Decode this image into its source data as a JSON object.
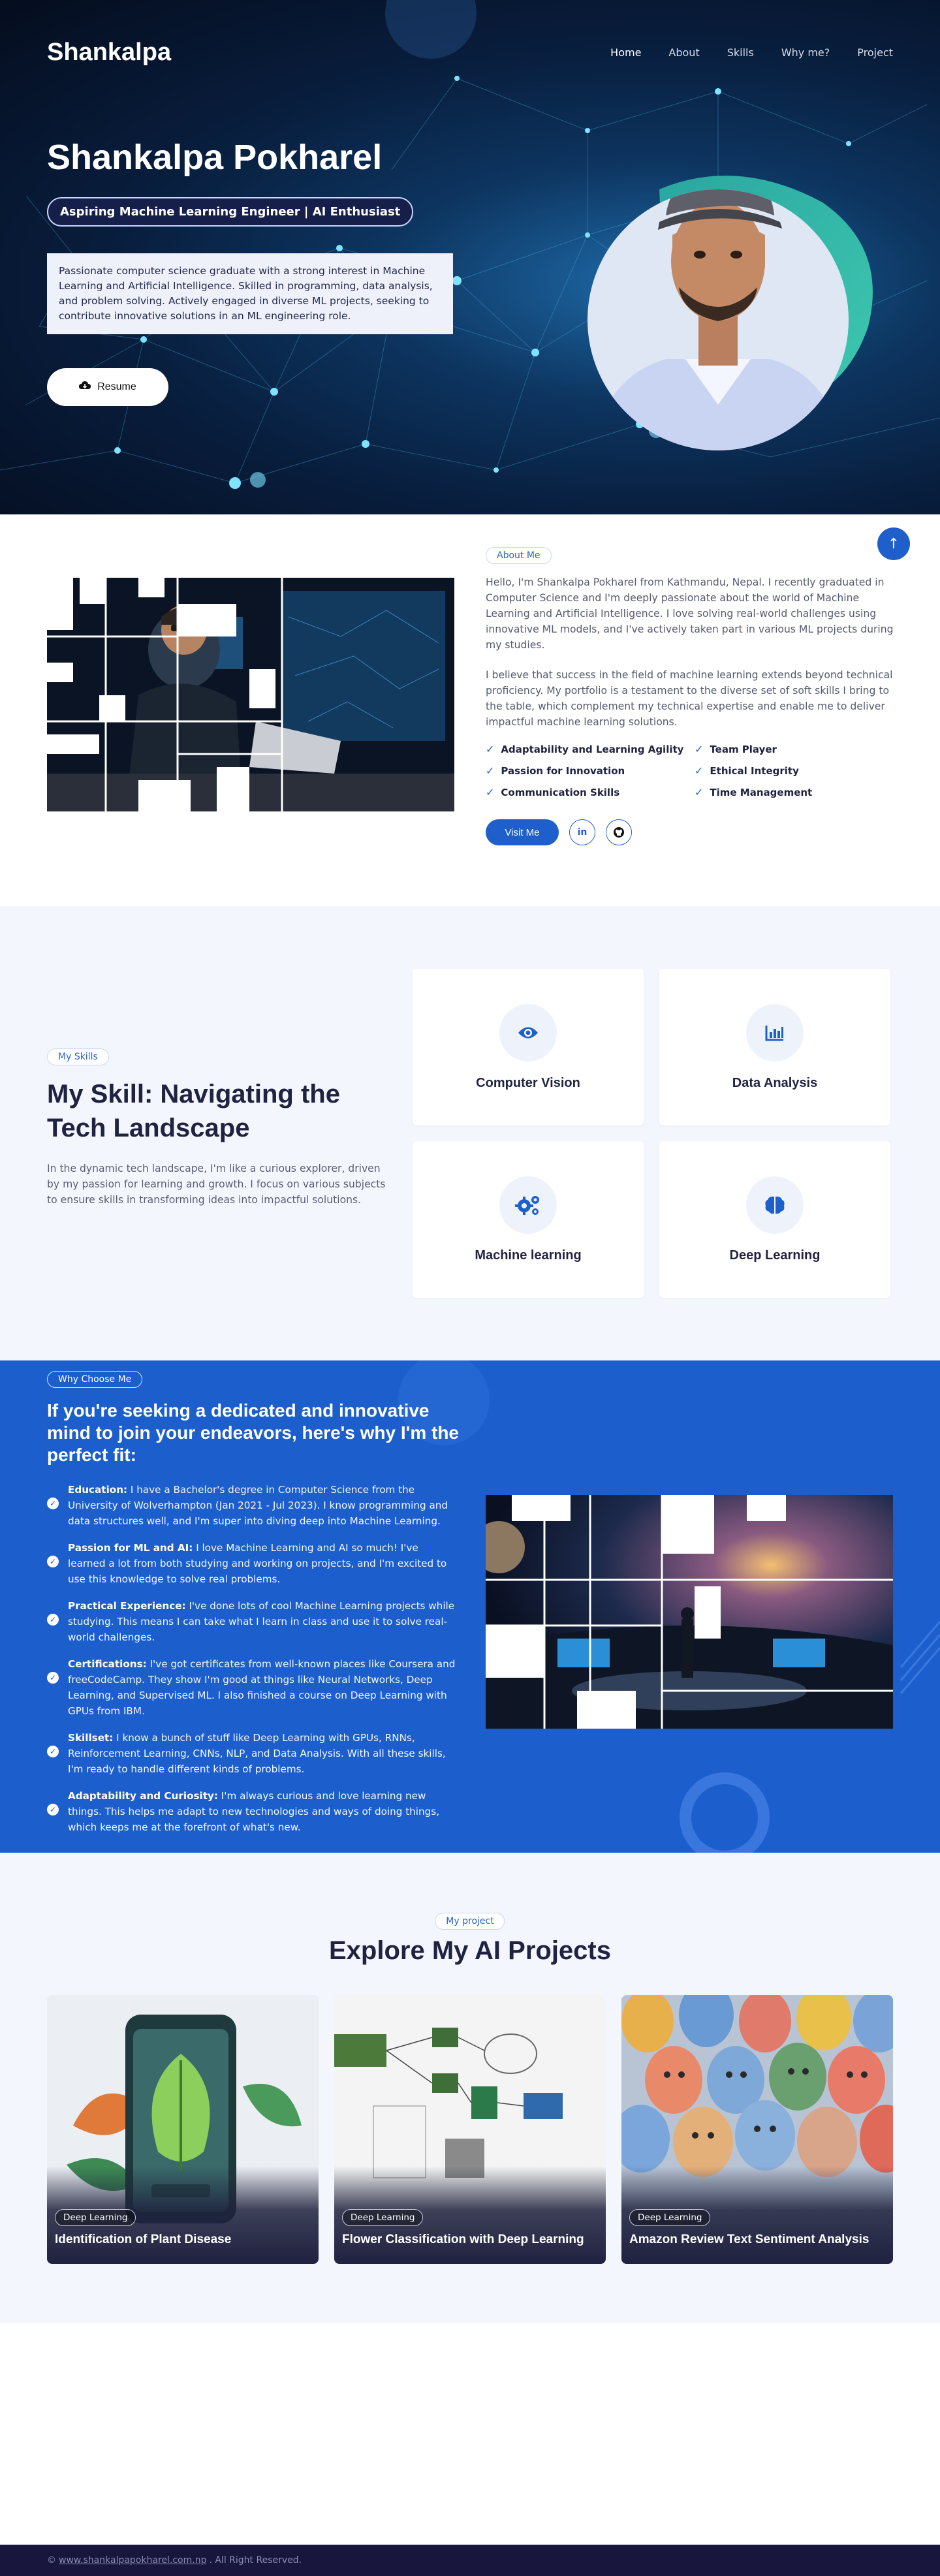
{
  "nav": {
    "brand": "Shankalpa",
    "links": [
      "Home",
      "About",
      "Skills",
      "Why me?",
      "Project"
    ]
  },
  "hero": {
    "name": "Shankalpa Pokharel",
    "badge": "Aspiring Machine Learning Engineer | AI Enthusiast",
    "description": "Passionate computer science graduate with a strong interest in Machine Learning and Artificial Intelligence. Skilled in programming, data analysis, and problem solving. Actively engaged in diverse ML projects, seeking to contribute innovative solutions in an ML engineering role.",
    "resume_label": "Resume"
  },
  "about": {
    "pill": "About Me",
    "para1": "Hello, I'm Shankalpa Pokharel from Kathmandu, Nepal. I recently graduated in Computer Science and I'm deeply passionate about the world of Machine Learning and Artificial Intelligence. I love solving real-world challenges using innovative ML models, and I've actively taken part in various ML projects during my studies.",
    "para2": "I believe that success in the field of machine learning extends beyond technical proficiency. My portfolio is a testament to the diverse set of soft skills I bring to the table, which complement my technical expertise and enable me to deliver impactful machine learning solutions.",
    "qualities": [
      "Adaptability and Learning Agility",
      "Team Player",
      "Passion for Innovation",
      "Ethical Integrity",
      "Communication Skills",
      "Time Management"
    ],
    "visit_label": "Visit Me",
    "linkedin": "in"
  },
  "skills": {
    "pill": "My Skills",
    "title": "My Skill: Navigating the Tech Landscape",
    "text": "In the dynamic tech landscape, I'm like a curious explorer, driven by my passion for learning and growth. I focus on various subjects to ensure skills in transforming ideas into impactful solutions.",
    "cards": [
      {
        "name": "Computer Vision",
        "icon": "eye-icon"
      },
      {
        "name": "Data Analysis",
        "icon": "bar-chart-icon"
      },
      {
        "name": "Machine learning",
        "icon": "gears-icon"
      },
      {
        "name": "Deep Learning",
        "icon": "brain-icon"
      }
    ]
  },
  "why": {
    "pill": "Why Choose Me",
    "title": "If you're seeking a dedicated and innovative mind to join your endeavors, here's why I'm the perfect fit:",
    "items": [
      {
        "label": "Education:",
        "text": " I have a Bachelor's degree in Computer Science from the University of Wolverhampton (Jan 2021 - Jul 2023). I know programming and data structures well, and I'm super into diving deep into Machine Learning."
      },
      {
        "label": "Passion for ML and AI:",
        "text": " I love Machine Learning and AI so much! I've learned a lot from both studying and working on projects, and I'm excited to use this knowledge to solve real problems."
      },
      {
        "label": "Practical Experience:",
        "text": " I've done lots of cool Machine Learning projects while studying. This means I can take what I learn in class and use it to solve real-world challenges."
      },
      {
        "label": "Certifications:",
        "text": " I've got certificates from well-known places like Coursera and freeCodeCamp. They show I'm good at things like Neural Networks, Deep Learning, and Supervised ML. I also finished a course on Deep Learning with GPUs from IBM."
      },
      {
        "label": "Skillset:",
        "text": " I know a bunch of stuff like Deep Learning with GPUs, RNNs, Reinforcement Learning, CNNs, NLP, and Data Analysis. With all these skills, I'm ready to handle different kinds of problems."
      },
      {
        "label": "Adaptability and Curiosity:",
        "text": " I'm always curious and love learning new things. This helps me adapt to new technologies and ways of doing things, which keeps me at the forefront of what's new."
      }
    ]
  },
  "projects": {
    "pill": "My project",
    "title": "Explore My AI Projects",
    "cards": [
      {
        "tag": "Deep Learning",
        "name": "Identification of Plant Disease"
      },
      {
        "tag": "Deep Learning",
        "name": "Flower Classification with Deep Learning"
      },
      {
        "tag": "Deep Learning",
        "name": "Amazon Review Text Sentiment Analysis"
      }
    ]
  },
  "footer": {
    "copy": "©",
    "link": "www.shankalpapokharel.com.np",
    "rights": ". All Right Reserved."
  }
}
